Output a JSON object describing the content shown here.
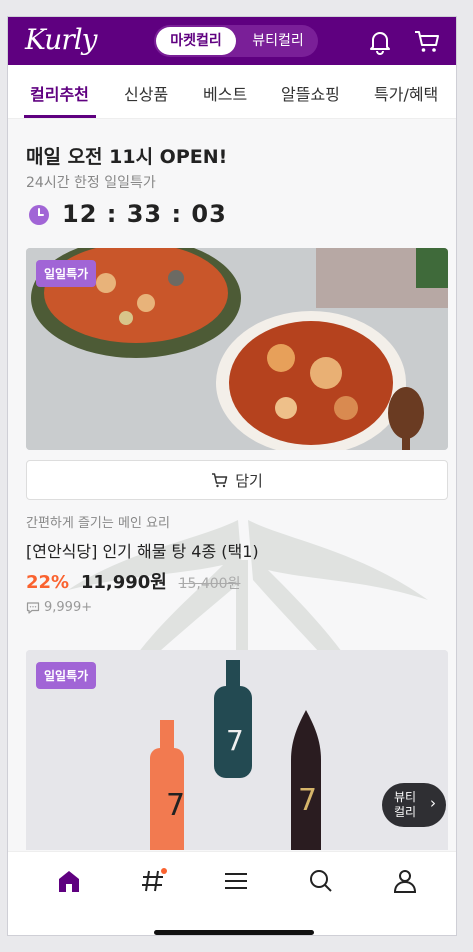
{
  "header": {
    "logo": "Kurly",
    "segment": {
      "active": "마켓컬리",
      "inactive": "뷰티컬리"
    },
    "icons": {
      "bell": "bell-icon",
      "cart": "cart-icon"
    }
  },
  "tabs": [
    {
      "label": "컬리추천",
      "active": true
    },
    {
      "label": "신상품",
      "active": false
    },
    {
      "label": "베스트",
      "active": false
    },
    {
      "label": "알뜰쇼핑",
      "active": false
    },
    {
      "label": "특가/혜택",
      "active": false
    }
  ],
  "deal": {
    "title": "매일 오전 11시 OPEN!",
    "subtitle": "24시간 한정 일일특가",
    "timer": "12 : 33 : 03"
  },
  "product": {
    "badge": "일일특가",
    "cart_label": "담기",
    "description": "간편하게 즐기는 메인 요리",
    "name": "[연안식당] 인기 해물 탕 4종 (택1)",
    "discount": "22%",
    "price": "11,990원",
    "original_price": "15,400원",
    "reviews": "9,999+"
  },
  "product2": {
    "badge": "일일특가",
    "beauty_button_line1": "뷰티",
    "beauty_button_line2": "컬리"
  },
  "bottom_nav": [
    "home-icon",
    "hashtag-icon",
    "menu-icon",
    "search-icon",
    "user-icon"
  ],
  "colors": {
    "brand": "#5f0080",
    "badge": "#a165d6",
    "discount": "#fa622f"
  }
}
